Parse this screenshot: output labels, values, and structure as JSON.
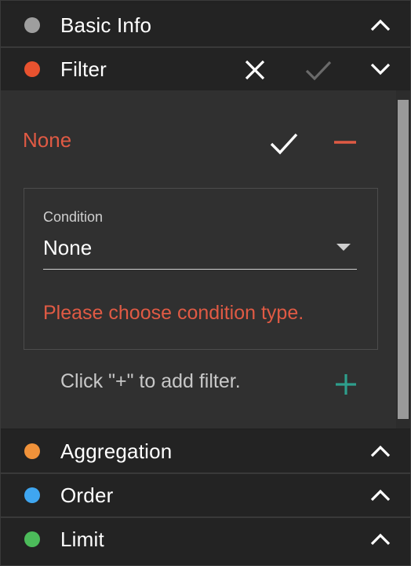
{
  "sections": {
    "basic_info": {
      "label": "Basic Info",
      "color": "#9e9e9e",
      "toggle_icon": "chevron-up-icon"
    },
    "filter": {
      "label": "Filter",
      "color": "#e8522f",
      "toggle_icon": "chevron-down-icon"
    },
    "aggregation": {
      "label": "Aggregation",
      "color": "#f0923a",
      "toggle_icon": "chevron-up-icon"
    },
    "order": {
      "label": "Order",
      "color": "#3fa6f0",
      "toggle_icon": "chevron-up-icon"
    },
    "limit": {
      "label": "Limit",
      "color": "#4cbb5a",
      "toggle_icon": "chevron-up-icon"
    }
  },
  "filter_body": {
    "rule_label": "None",
    "condition_label": "Condition",
    "condition_value": "None",
    "error_text": "Please choose condition type.",
    "hint_text": "Click \"+\" to add filter."
  },
  "colors": {
    "error_red": "#e05a44",
    "add_teal": "#2e9e8c",
    "panel_bg": "#303030",
    "header_bg": "#232323"
  }
}
